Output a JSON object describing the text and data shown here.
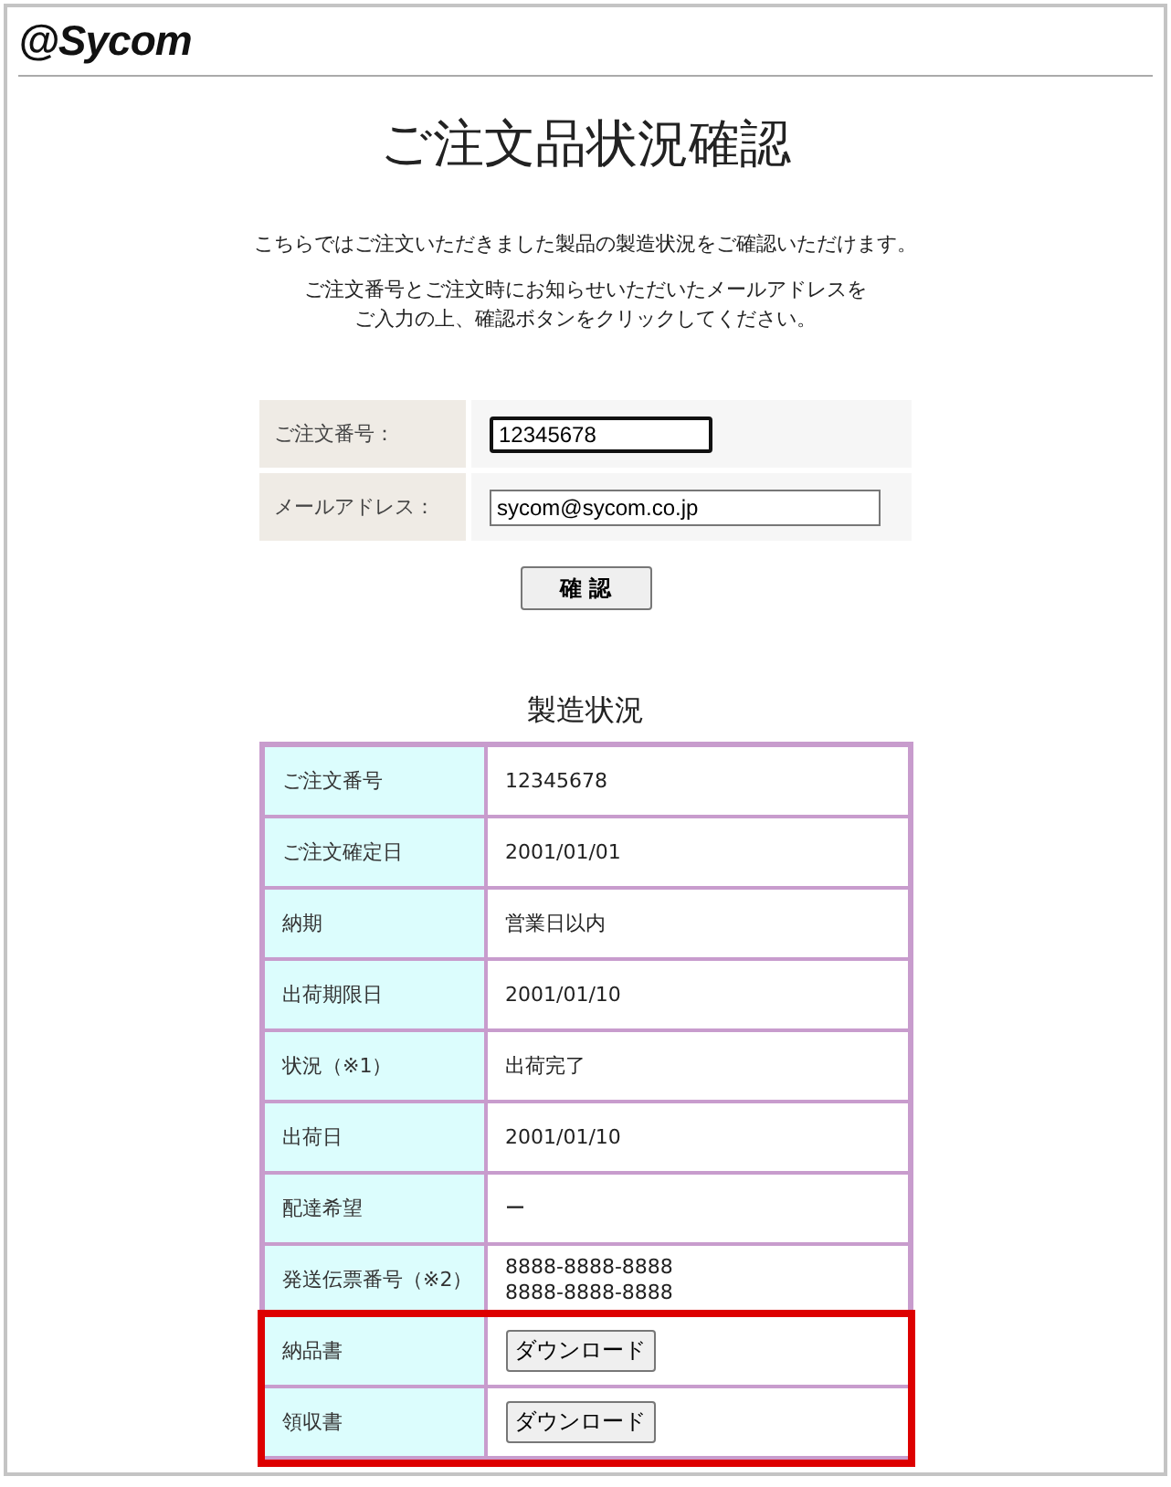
{
  "header": {
    "logo": "@Sycom"
  },
  "title": "ご注文品状況確認",
  "intro": [
    [
      "こちらではご注文いただきました製品の製造状況をご確認いただけます。"
    ],
    [
      "ご注文番号とご注文時にお知らせいただいたメールアドレスを",
      "ご入力の上、確認ボタンをクリックしてください。"
    ]
  ],
  "form": {
    "fields": [
      {
        "label": "ご注文番号：",
        "value": "12345678",
        "focused": true
      },
      {
        "label": "メールアドレス：",
        "value": "sycom@sycom.co.jp",
        "focused": false
      }
    ],
    "submit": "確 認"
  },
  "status": {
    "title": "製造状況",
    "rows": [
      {
        "label": "ご注文番号",
        "kind": "text",
        "values": [
          "12345678"
        ],
        "highlighted": false
      },
      {
        "label": "ご注文確定日",
        "kind": "text",
        "values": [
          "2001/01/01"
        ],
        "highlighted": false
      },
      {
        "label": "納期",
        "kind": "text",
        "values": [
          "営業日以内"
        ],
        "highlighted": false
      },
      {
        "label": "出荷期限日",
        "kind": "text",
        "values": [
          "2001/01/10"
        ],
        "highlighted": false
      },
      {
        "label": "状況（※1）",
        "kind": "text",
        "values": [
          "出荷完了"
        ],
        "highlighted": false
      },
      {
        "label": "出荷日",
        "kind": "text",
        "values": [
          "2001/01/10"
        ],
        "highlighted": false
      },
      {
        "label": "配達希望",
        "kind": "text",
        "values": [
          "ー"
        ],
        "highlighted": false
      },
      {
        "label": "発送伝票番号（※2）",
        "kind": "text",
        "values": [
          "8888-8888-8888",
          "8888-8888-8888"
        ],
        "highlighted": false
      },
      {
        "label": "納品書",
        "kind": "button",
        "values": [
          "ダウンロード"
        ],
        "highlighted": true
      },
      {
        "label": "領収書",
        "kind": "button",
        "values": [
          "ダウンロード"
        ],
        "highlighted": true
      }
    ]
  }
}
